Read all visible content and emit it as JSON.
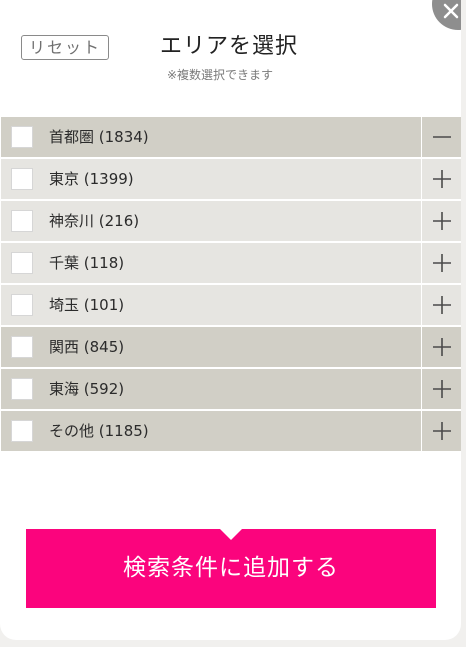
{
  "header": {
    "reset_label": "リセット",
    "title": "エリアを選択",
    "subtitle": "※複数選択できます"
  },
  "areas": [
    {
      "label": "首都圏 (1834)",
      "expanded": true,
      "checked": false
    },
    {
      "label": "東京 (1399)",
      "expanded": false,
      "checked": false
    },
    {
      "label": "神奈川 (216)",
      "expanded": false,
      "checked": false
    },
    {
      "label": "千葉 (118)",
      "expanded": false,
      "checked": false
    },
    {
      "label": "埼玉 (101)",
      "expanded": false,
      "checked": false
    },
    {
      "label": "関西 (845)",
      "expanded": false,
      "checked": false
    },
    {
      "label": "東海 (592)",
      "expanded": false,
      "checked": false
    },
    {
      "label": "その他 (1185)",
      "expanded": false,
      "checked": false
    }
  ],
  "footer": {
    "add_label": "検索条件に追加する"
  },
  "colors": {
    "accent": "#fb047d",
    "row_light": "#e6e5e1",
    "row_dark": "#d1cfc6",
    "close_button": "#8e8e8e"
  },
  "icons": {
    "close": "close-icon",
    "expand": "plus-icon",
    "collapse": "minus-icon"
  }
}
